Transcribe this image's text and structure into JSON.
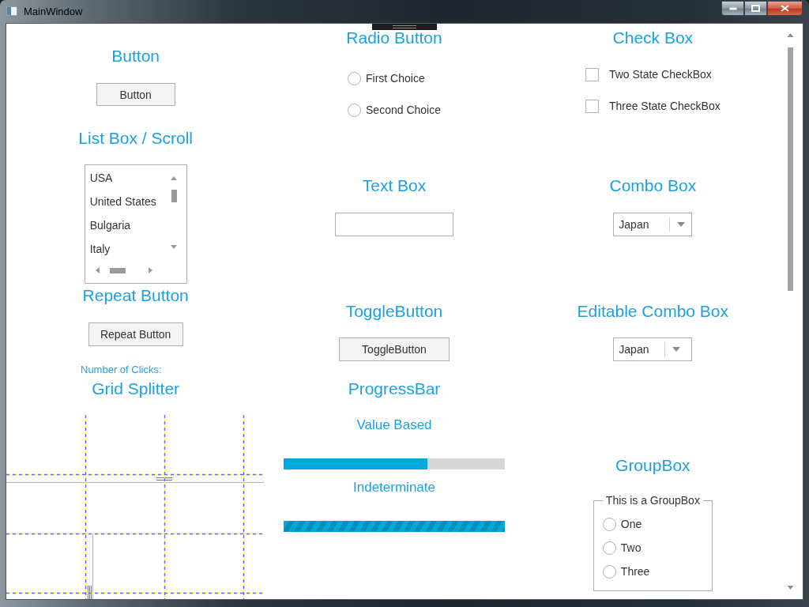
{
  "window": {
    "title": "MainWindow"
  },
  "sections": [
    {
      "kind": "button",
      "heading": "Button",
      "label": "Button"
    },
    {
      "kind": "radio",
      "heading": "Radio Button",
      "options": [
        {
          "label": "First Choice",
          "selected": false
        },
        {
          "label": "Second Choice",
          "selected": false
        }
      ]
    },
    {
      "kind": "checkbox",
      "heading": "Check Box",
      "options": [
        {
          "label": "Two State CheckBox",
          "checked": false
        },
        {
          "label": "Three State CheckBox",
          "checked": false
        }
      ]
    },
    {
      "kind": "listbox",
      "heading": "List Box / Scroll",
      "items": [
        {
          "label": "USA",
          "selected": false
        },
        {
          "label": "United States",
          "selected": false
        },
        {
          "label": "Bulgaria",
          "selected": false
        },
        {
          "label": "Italy",
          "selected": false
        }
      ]
    },
    {
      "kind": "textbox",
      "heading": "Text Box"
    },
    {
      "kind": "combo",
      "heading": "Combo Box",
      "value": "Japan"
    },
    {
      "kind": "repeat",
      "heading": "Repeat Button",
      "label": "Repeat Button",
      "note": "Number of Clicks:"
    },
    {
      "kind": "toggle",
      "heading": "ToggleButton",
      "label": "ToggleButton",
      "on": false
    },
    {
      "kind": "editable_combo",
      "heading": "Editable Combo Box",
      "value": "Japan"
    },
    {
      "kind": "grid_splitter",
      "heading": "Grid Splitter"
    },
    {
      "kind": "progress",
      "heading": "ProgressBar",
      "bars": [
        {
          "label": "Value Based",
          "indeterminate": false,
          "level": 0.65
        },
        {
          "label": "Indeterminate",
          "indeterminate": true
        }
      ]
    },
    {
      "kind": "groupbox",
      "heading": "GroupBox",
      "title": "This is a GroupBox",
      "options": [
        {
          "label": "One",
          "selected": false
        },
        {
          "label": "Two",
          "selected": false
        },
        {
          "label": "Three",
          "selected": false
        }
      ]
    }
  ]
}
